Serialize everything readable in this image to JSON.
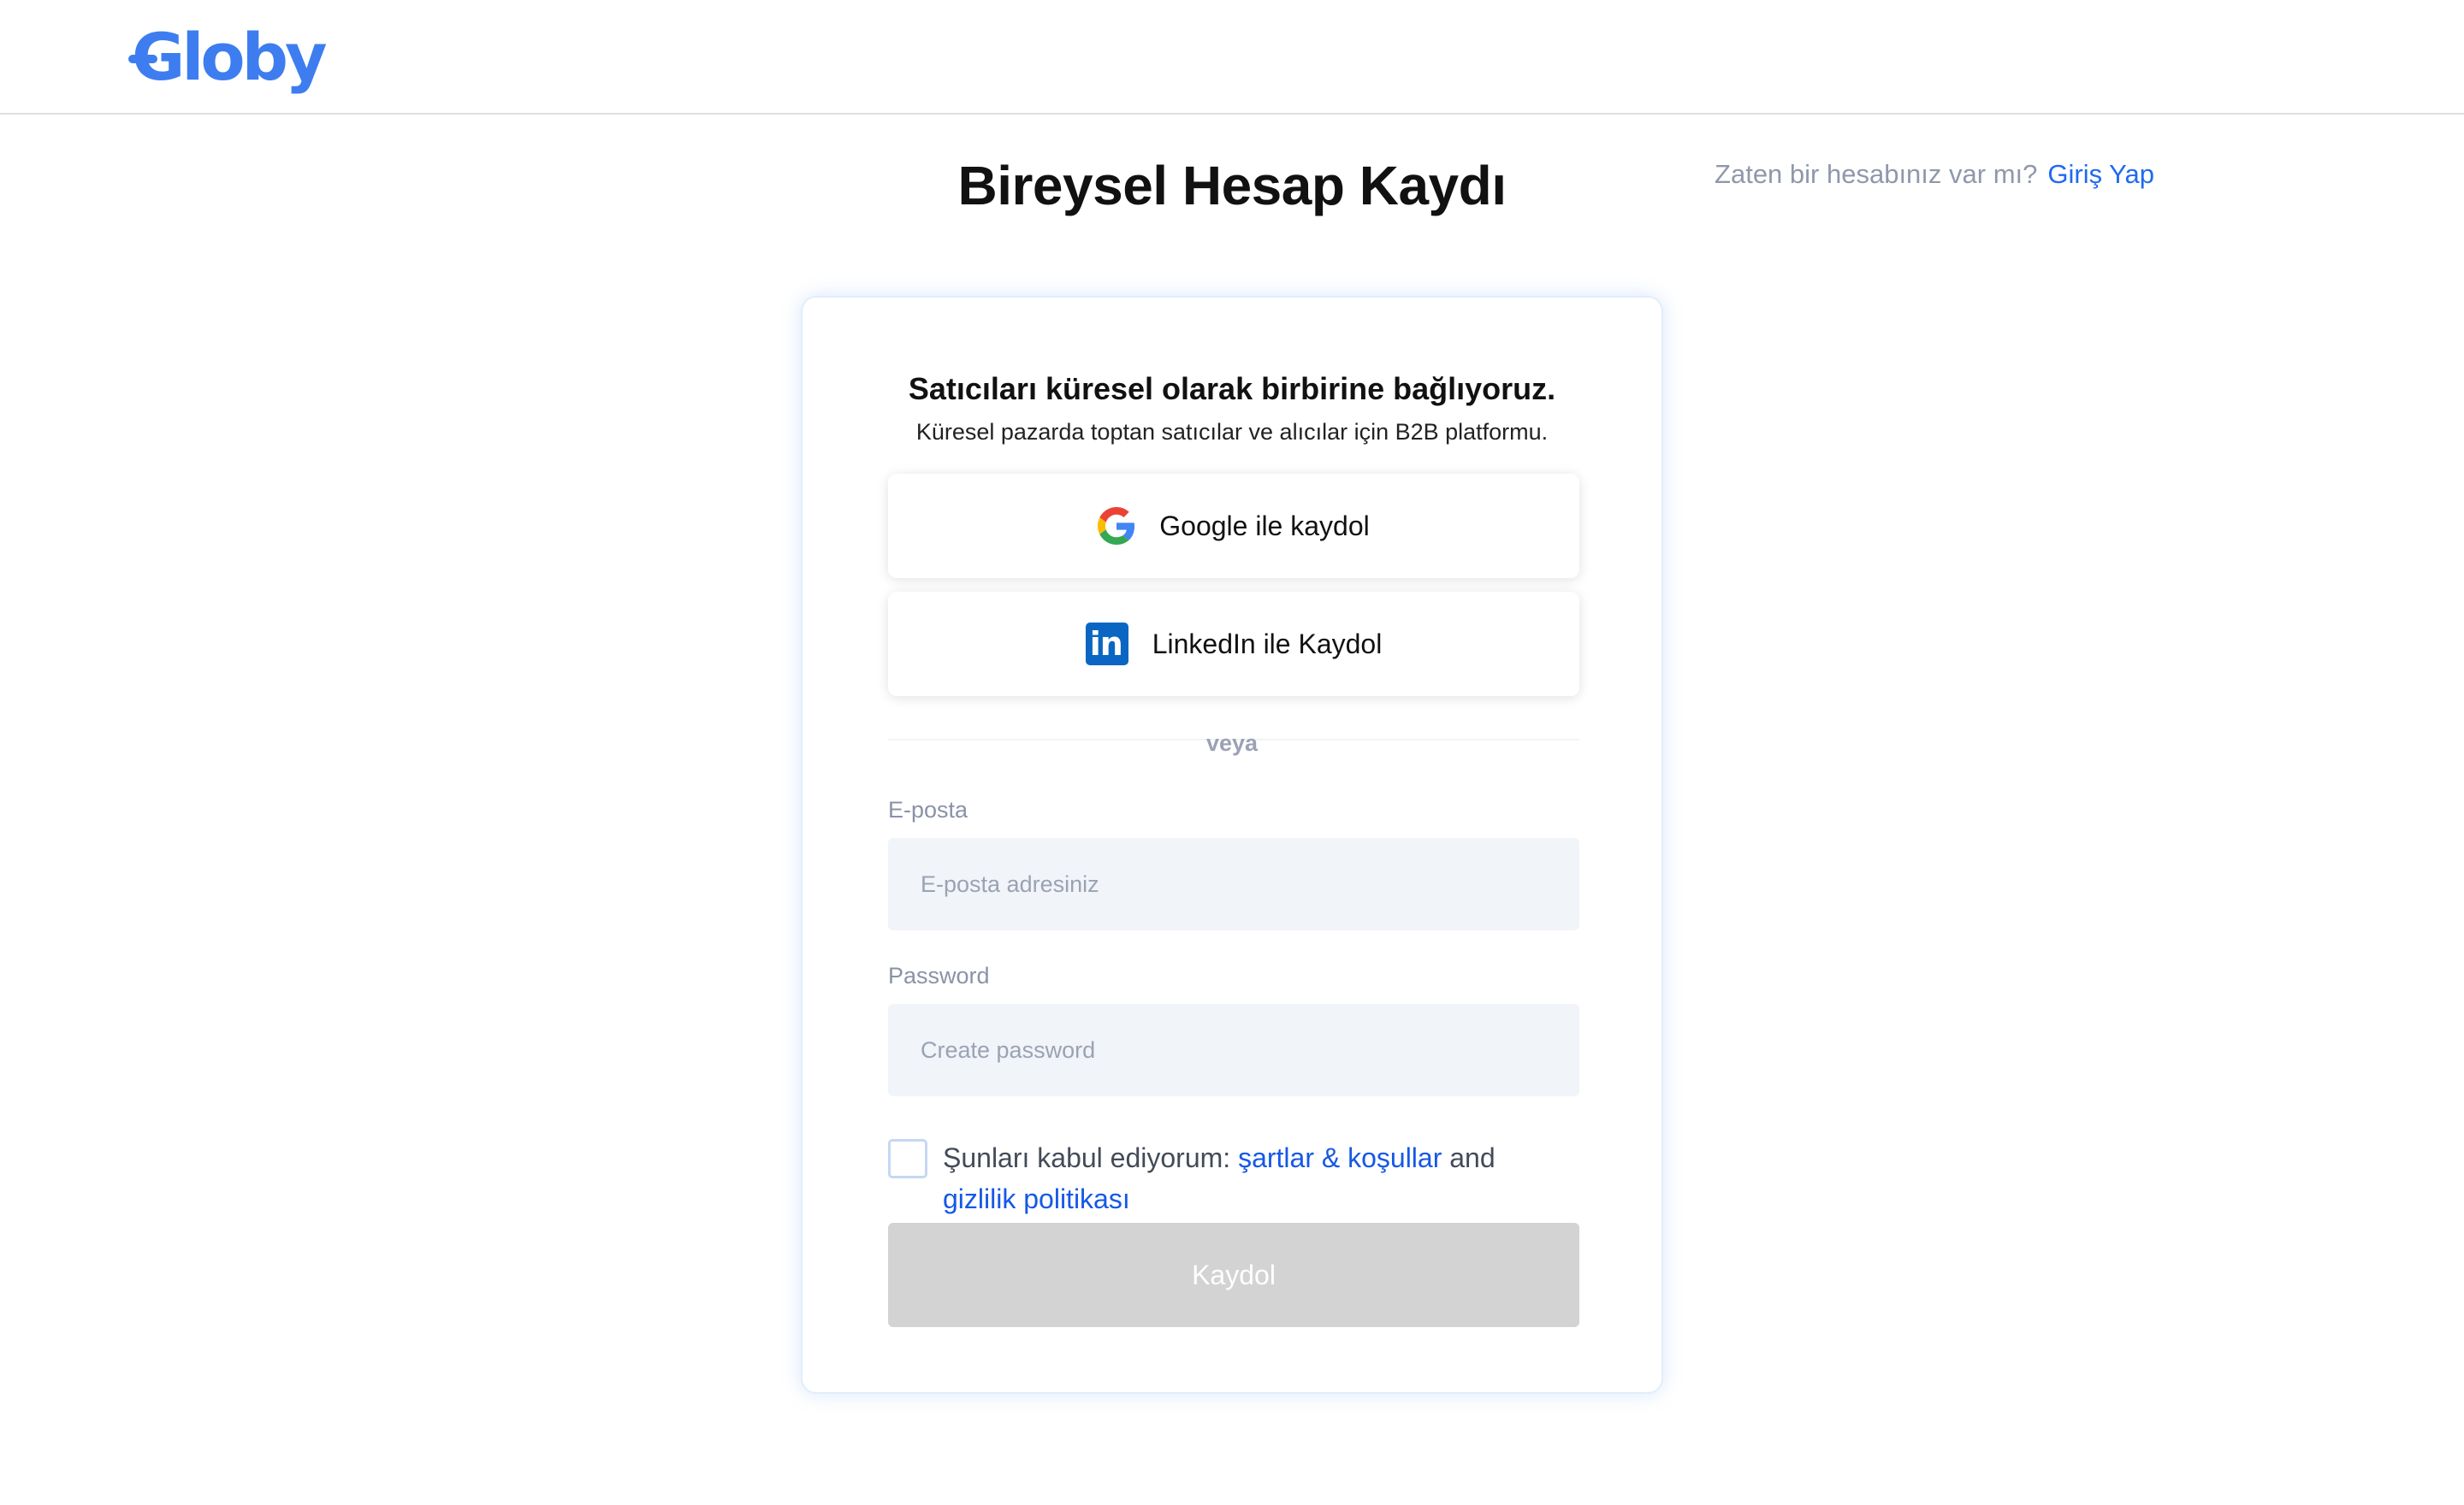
{
  "brand": {
    "logo_text": "Globy",
    "color": "#3d7df0"
  },
  "page": {
    "title": "Bireysel Hesap Kaydı"
  },
  "login_prompt": {
    "text": "Zaten bir hesabınız var mı?",
    "link": "Giriş Yap"
  },
  "card": {
    "tagline": "Satıcıları küresel olarak birbirine bağlıyoruz.",
    "subtagline": "Küresel pazarda toptan satıcılar ve alıcılar için B2B platformu.",
    "google_button": "Google ile kaydol",
    "linkedin_button": "LinkedIn ile Kaydol",
    "divider_text": "veya",
    "email": {
      "label": "E-posta",
      "placeholder": "E-posta adresiniz",
      "value": ""
    },
    "password": {
      "label": "Password",
      "placeholder": "Create password",
      "value": ""
    },
    "terms": {
      "checked": false,
      "prefix": "Şunları kabul ediyorum:",
      "terms_link": "şartlar & koşullar",
      "connector": "and",
      "privacy_link": "gizlilik politikası"
    },
    "submit_button": "Kaydol"
  },
  "icons": {
    "google": "google-icon",
    "linkedin": "linkedin-icon",
    "checkbox": "checkbox-unchecked"
  },
  "colors": {
    "link": "#1f6af0",
    "submit_disabled": "#d3d3d3",
    "input_bg": "#f1f4f8",
    "linkedin_brand": "#0a66c2"
  }
}
